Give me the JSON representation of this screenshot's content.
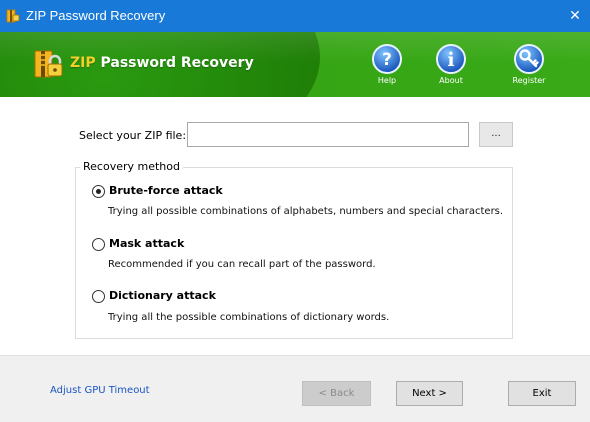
{
  "window": {
    "title": "ZIP Password Recovery",
    "close_glyph": "✕"
  },
  "banner": {
    "brand_accent": "ZIP",
    "brand_rest": " Password Recovery",
    "accent_color": "#f2cf2a",
    "tools": [
      {
        "label": "Help",
        "icon": "question-icon"
      },
      {
        "label": "About",
        "icon": "info-icon"
      },
      {
        "label": "Register",
        "icon": "key-icon"
      }
    ]
  },
  "file": {
    "label": "Select your ZIP file:",
    "value": "",
    "browse_label": "..."
  },
  "method": {
    "group_title": "Recovery method",
    "options": [
      {
        "label": "Brute-force attack",
        "description": "Trying all possible combinations of alphabets, numbers and special characters.",
        "selected": true
      },
      {
        "label": "Mask attack",
        "description": "Recommended if you can recall part of the password.",
        "selected": false
      },
      {
        "label": "Dictionary attack",
        "description": "Trying all the possible combinations of dictionary words.",
        "selected": false
      }
    ]
  },
  "footer": {
    "gpu_link": "Adjust GPU Timeout",
    "back_label": "< Back",
    "next_label": "Next >",
    "exit_label": "Exit",
    "back_disabled": true
  },
  "colors": {
    "titlebar": "#1879d8",
    "banner_green": "#35a414",
    "link": "#1a56c2"
  }
}
